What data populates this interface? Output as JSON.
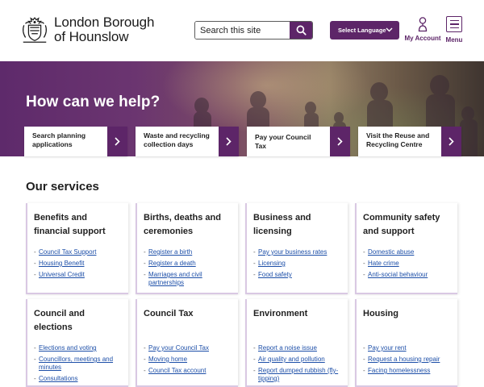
{
  "header": {
    "brand_line1": "London Borough",
    "brand_line2": "of Hounslow",
    "search_placeholder": "Search this site",
    "language_label": "Select Language",
    "account_label": "My Account",
    "menu_label": "Menu"
  },
  "hero": {
    "title": "How can we help?",
    "quick_links": [
      {
        "label": "Search planning applications"
      },
      {
        "label": "Waste and recycling collection days"
      },
      {
        "label": "Pay your Council Tax"
      },
      {
        "label": "Visit the Reuse and Recycling Centre"
      }
    ]
  },
  "services": {
    "title": "Our services",
    "cards": [
      {
        "title": "Benefits and financial support",
        "links": [
          "Council Tax Support",
          "Housing Benefit",
          "Universal Credit"
        ]
      },
      {
        "title": "Births, deaths and ceremonies",
        "links": [
          "Register a birth",
          "Register a death",
          "Marriages and civil partnerships"
        ]
      },
      {
        "title": "Business and licensing",
        "links": [
          "Pay your business rates",
          "Licensing",
          "Food safety"
        ]
      },
      {
        "title": "Community safety and support",
        "links": [
          "Domestic abuse",
          "Hate crime",
          "Anti-social behaviour"
        ]
      },
      {
        "title": "Council and elections",
        "links": [
          "Elections and voting",
          "Councillors, meetings and minutes",
          "Consultations"
        ]
      },
      {
        "title": "Council Tax",
        "links": [
          "Pay your Council Tax",
          "Moving home",
          "Council Tax account"
        ]
      },
      {
        "title": "Environment",
        "links": [
          "Report a noise issue",
          "Air quality and pollution",
          "Report dumped rubbish (fly-tipping)"
        ]
      },
      {
        "title": "Housing",
        "links": [
          "Pay your rent",
          "Request a housing repair",
          "Facing homelessness"
        ]
      }
    ]
  },
  "colors": {
    "brand_purple": "#5d2568",
    "link_blue": "#1d4fa8",
    "card_border": "#d9c8e3"
  },
  "icons": [
    "crest-logo-icon",
    "search-icon",
    "chevron-down-icon",
    "account-icon",
    "menu-icon",
    "chevron-right-icon"
  ]
}
